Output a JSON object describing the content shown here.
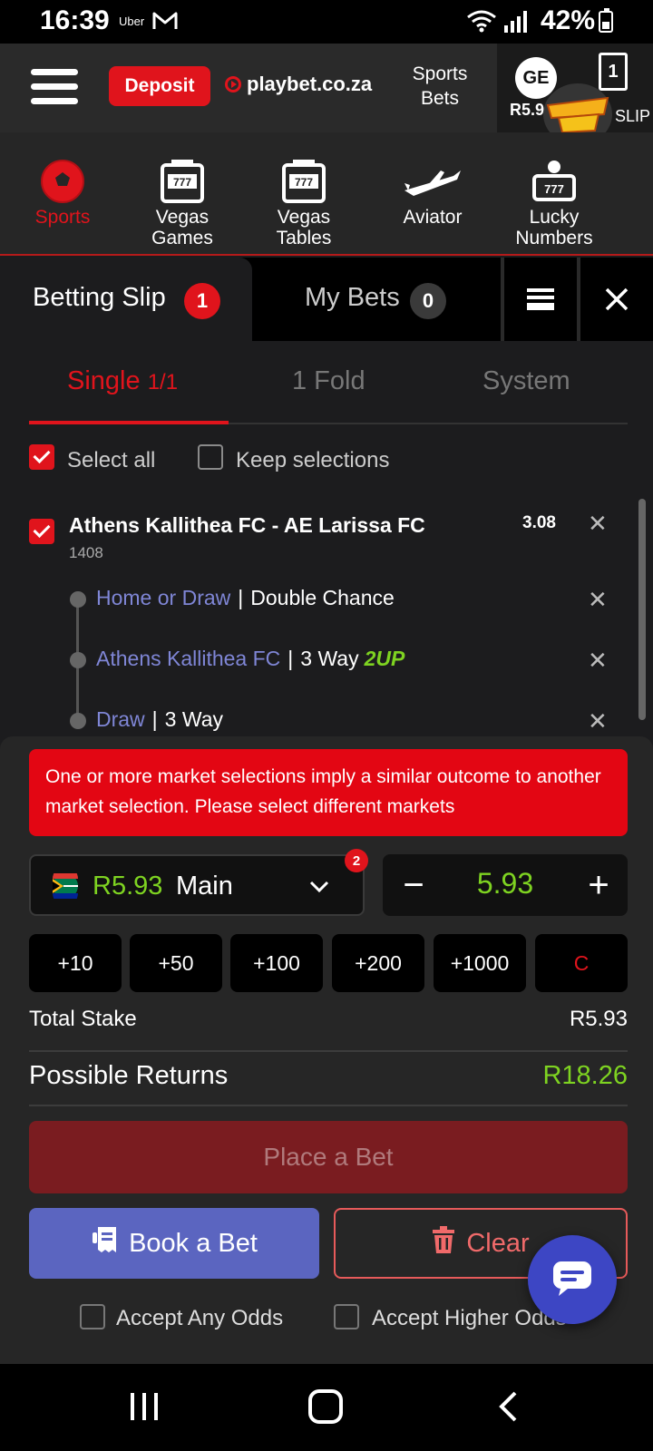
{
  "status_bar": {
    "time": "16:39",
    "app_tag": "Uber",
    "battery": "42%"
  },
  "header": {
    "deposit": "Deposit",
    "logo": "playbet.co.za",
    "sports_bets_line1": "Sports",
    "sports_bets_line2": "Bets",
    "avatar": "GE",
    "balance": "R5.9",
    "slip_count": "1",
    "slip_label": "SLIP"
  },
  "nav": [
    {
      "label": "Sports",
      "line2": "",
      "icon": "soccer-ball-icon",
      "active": true
    },
    {
      "label": "Vegas",
      "line2": "Games",
      "icon": "slot-machine-icon"
    },
    {
      "label": "Vegas",
      "line2": "Tables",
      "icon": "slot-machine-icon"
    },
    {
      "label": "Aviator",
      "line2": "",
      "icon": "airplane-icon"
    },
    {
      "label": "Lucky",
      "line2": "Numbers",
      "icon": "lucky-numbers-icon"
    }
  ],
  "slip_tabs": {
    "betting_slip": "Betting Slip",
    "betting_slip_count": "1",
    "my_bets": "My Bets",
    "my_bets_count": "0"
  },
  "sub_tabs": {
    "single": "Single",
    "single_count": "1/1",
    "fold": "1 Fold",
    "system": "System"
  },
  "select": {
    "select_all": "Select all",
    "keep": "Keep selections"
  },
  "selection": {
    "match": "Athens Kallithea FC - AE Larissa FC",
    "code": "1408",
    "odds": "3.08",
    "legs": [
      {
        "pick": "Home or Draw",
        "market": "Double Chance",
        "tag": ""
      },
      {
        "pick": "Athens Kallithea FC",
        "market": "3 Way",
        "tag": "2UP"
      },
      {
        "pick": "Draw",
        "market": "3 Way",
        "tag": ""
      }
    ]
  },
  "warning": "One or more market selections imply a similar outcome to another market selection. Please select different markets",
  "wallet": {
    "balance": "R5.93",
    "name": "Main",
    "badge": "2"
  },
  "stake": {
    "value": "5.93",
    "minus": "−",
    "plus": "+"
  },
  "quick_stakes": [
    "+10",
    "+50",
    "+100",
    "+200",
    "+1000",
    "C"
  ],
  "totals": {
    "total_stake_label": "Total Stake",
    "total_stake": "R5.93",
    "returns_label": "Possible Returns",
    "returns": "R18.26"
  },
  "buttons": {
    "place": "Place a Bet",
    "book": "Book a Bet",
    "clear": "Clear"
  },
  "accept": {
    "any": "Accept Any Odds",
    "higher": "Accept Higher Odds"
  },
  "colors": {
    "accent_red": "#e0141c",
    "green": "#7ed321",
    "pick_blue": "#7f86d6",
    "book_blue": "#5b65c0"
  }
}
